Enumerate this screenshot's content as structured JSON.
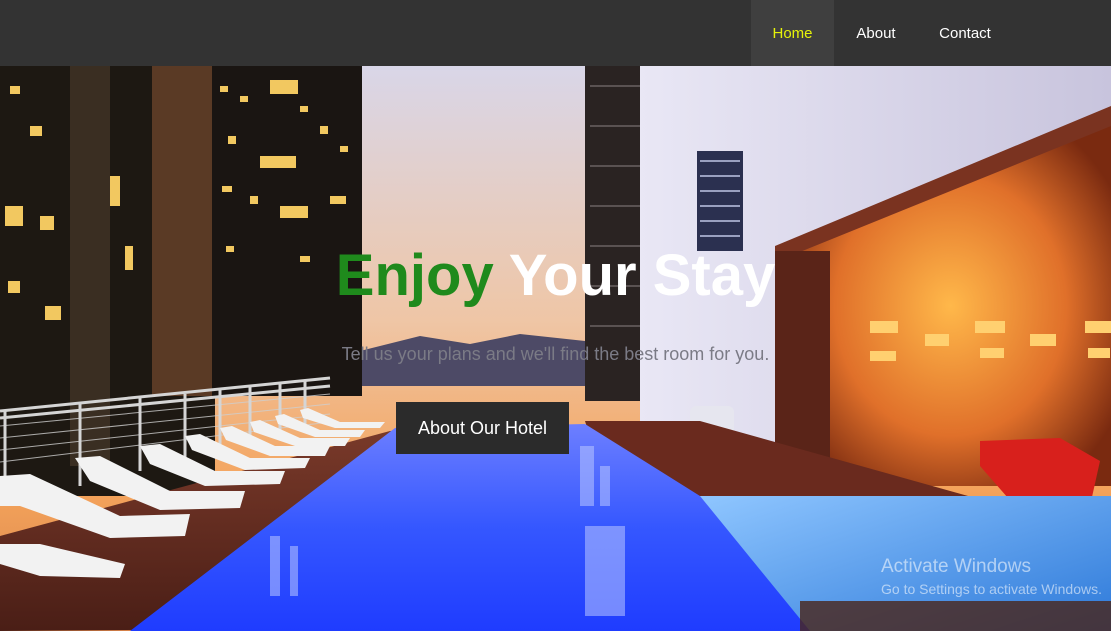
{
  "nav": {
    "items": [
      {
        "label": "Home",
        "active": true
      },
      {
        "label": "About",
        "active": false
      },
      {
        "label": "Contact",
        "active": false
      }
    ]
  },
  "hero": {
    "title_part1": "Enjoy",
    "title_part2": "Your Stay",
    "subtitle": "Tell us your plans and we'll find the best room for you.",
    "button_label": "About Our Hotel"
  },
  "watermark": {
    "line1": "Activate Windows",
    "line2": "Go to Settings to activate Windows."
  },
  "colors": {
    "nav_bg": "#333333",
    "nav_active_text": "#e6f30a",
    "title_accent": "#1f8a1c",
    "button_bg": "#2b2b2b"
  }
}
